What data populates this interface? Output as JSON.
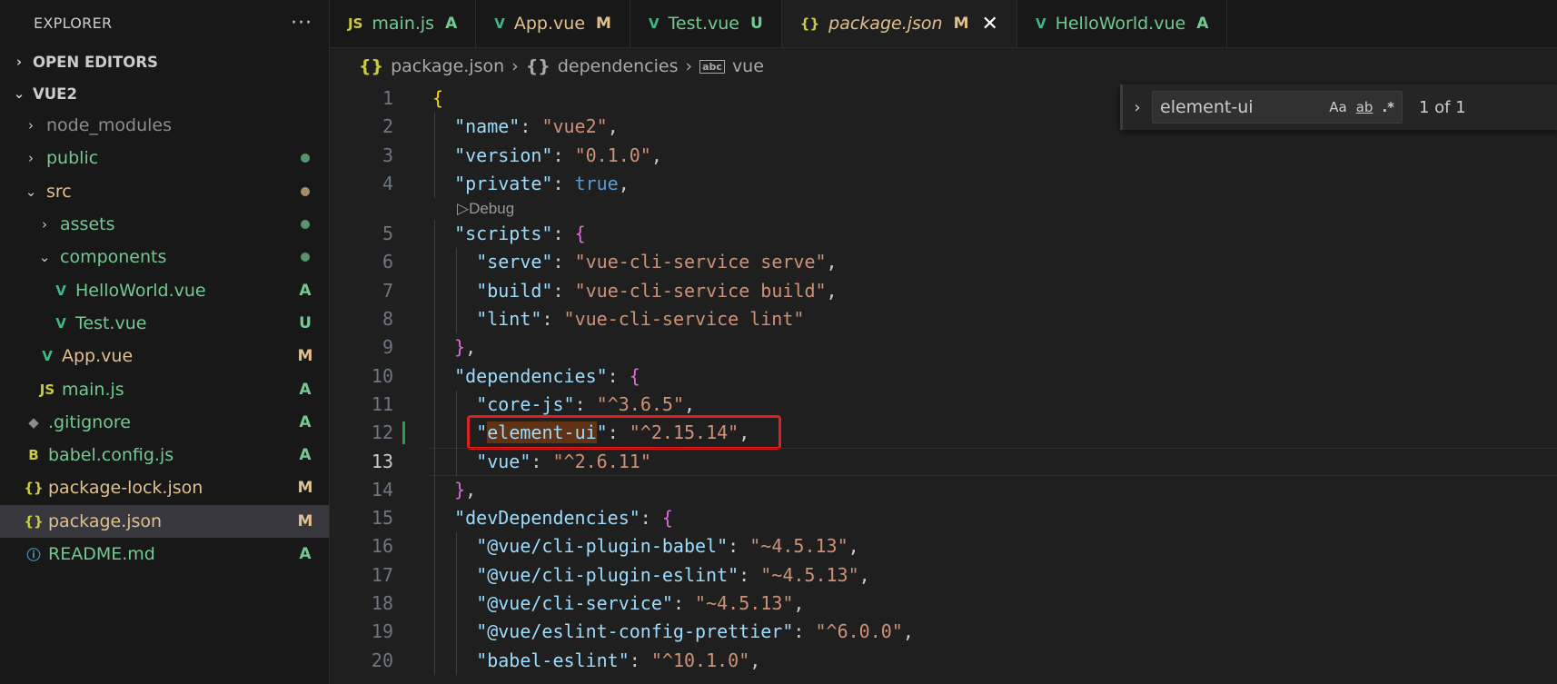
{
  "colors": {
    "vue_green": "#41b883",
    "js_yellow": "#cbcb41",
    "json_yellow": "#cbcb41",
    "added": "#73c991",
    "modified": "#e2c08d",
    "untracked": "#73c991",
    "folder_text": "#cccccc",
    "ignored": "#8c8c8c"
  },
  "sidebar": {
    "title": "EXPLORER",
    "more": "···",
    "open_editors": "OPEN EDITORS",
    "project": "VUE2",
    "tree": [
      {
        "label": "node_modules",
        "status": "",
        "icon": "chevron-right-icon",
        "glyph": "›",
        "depth": 1,
        "color": "#8c8c8c",
        "dot": ""
      },
      {
        "label": "public",
        "status": "",
        "icon": "chevron-right-icon",
        "glyph": "›",
        "depth": 1,
        "color": "#73c991",
        "dot": "#73c991"
      },
      {
        "label": "src",
        "status": "",
        "icon": "chevron-down-icon",
        "glyph": "⌄",
        "depth": 1,
        "color": "#e2c08d",
        "dot": "#e2c08d"
      },
      {
        "label": "assets",
        "status": "",
        "icon": "chevron-right-icon",
        "glyph": "›",
        "depth": 2,
        "color": "#73c991",
        "dot": "#73c991"
      },
      {
        "label": "components",
        "status": "",
        "icon": "chevron-down-icon",
        "glyph": "⌄",
        "depth": 2,
        "color": "#73c991",
        "dot": "#73c991"
      },
      {
        "label": "HelloWorld.vue",
        "status": "A",
        "icon": "vue-file-icon",
        "glyph": "V",
        "depth": 3,
        "color": "#73c991",
        "dot": ""
      },
      {
        "label": "Test.vue",
        "status": "U",
        "icon": "vue-file-icon",
        "glyph": "V",
        "depth": 3,
        "color": "#73c991",
        "dot": ""
      },
      {
        "label": "App.vue",
        "status": "M",
        "icon": "vue-file-icon",
        "glyph": "V",
        "depth": 2,
        "color": "#e2c08d",
        "dot": ""
      },
      {
        "label": "main.js",
        "status": "A",
        "icon": "js-file-icon",
        "glyph": "JS",
        "depth": 2,
        "color": "#73c991",
        "dot": ""
      },
      {
        "label": ".gitignore",
        "status": "A",
        "icon": "git-file-icon",
        "glyph": "◆",
        "depth": 1,
        "color": "#73c991",
        "dot": ""
      },
      {
        "label": "babel.config.js",
        "status": "A",
        "icon": "babel-file-icon",
        "glyph": "B",
        "depth": 1,
        "color": "#73c991",
        "dot": ""
      },
      {
        "label": "package-lock.json",
        "status": "M",
        "icon": "json-file-icon",
        "glyph": "{}",
        "depth": 1,
        "color": "#e2c08d",
        "dot": ""
      },
      {
        "label": "package.json",
        "status": "M",
        "icon": "json-file-icon",
        "glyph": "{}",
        "depth": 1,
        "color": "#e2c08d",
        "dot": "",
        "selected": true
      },
      {
        "label": "README.md",
        "status": "A",
        "icon": "info-icon",
        "glyph": "ⓘ",
        "depth": 1,
        "color": "#73c991",
        "dot": ""
      }
    ]
  },
  "tabs": [
    {
      "label": "main.js",
      "status": "A",
      "icon": "js-file-icon",
      "glyph": "JS",
      "color": "#73c991",
      "active": false
    },
    {
      "label": "App.vue",
      "status": "M",
      "icon": "vue-file-icon",
      "glyph": "V",
      "color": "#e2c08d",
      "active": false
    },
    {
      "label": "Test.vue",
      "status": "U",
      "icon": "vue-file-icon",
      "glyph": "V",
      "color": "#73c991",
      "active": false
    },
    {
      "label": "package.json",
      "status": "M",
      "icon": "json-file-icon",
      "glyph": "{}",
      "color": "#e2c08d",
      "active": true,
      "close": "✕"
    },
    {
      "label": "HelloWorld.vue",
      "status": "A",
      "icon": "vue-file-icon",
      "glyph": "V",
      "color": "#73c991",
      "active": false
    }
  ],
  "breadcrumb": {
    "file": "package.json",
    "section": "dependencies",
    "key": "vue",
    "sep": "›"
  },
  "codelens": "▷Debug",
  "code_lines": [
    {
      "n": "1",
      "indent": 0,
      "parts": [
        [
          "br1",
          "{"
        ]
      ]
    },
    {
      "n": "2",
      "indent": 1,
      "parts": [
        [
          "k",
          "\"name\""
        ],
        [
          "p",
          ": "
        ],
        [
          "s",
          "\"vue2\""
        ],
        [
          "p",
          ","
        ]
      ]
    },
    {
      "n": "3",
      "indent": 1,
      "parts": [
        [
          "k",
          "\"version\""
        ],
        [
          "p",
          ": "
        ],
        [
          "s",
          "\"0.1.0\""
        ],
        [
          "p",
          ","
        ]
      ]
    },
    {
      "n": "4",
      "indent": 1,
      "parts": [
        [
          "k",
          "\"private\""
        ],
        [
          "p",
          ": "
        ],
        [
          "b",
          "true"
        ],
        [
          "p",
          ","
        ]
      ]
    },
    {
      "n": "5",
      "indent": 1,
      "parts": [
        [
          "k",
          "\"scripts\""
        ],
        [
          "p",
          ": "
        ],
        [
          "br2",
          "{"
        ]
      ]
    },
    {
      "n": "6",
      "indent": 2,
      "parts": [
        [
          "k",
          "\"serve\""
        ],
        [
          "p",
          ": "
        ],
        [
          "s",
          "\"vue-cli-service serve\""
        ],
        [
          "p",
          ","
        ]
      ]
    },
    {
      "n": "7",
      "indent": 2,
      "parts": [
        [
          "k",
          "\"build\""
        ],
        [
          "p",
          ": "
        ],
        [
          "s",
          "\"vue-cli-service build\""
        ],
        [
          "p",
          ","
        ]
      ]
    },
    {
      "n": "8",
      "indent": 2,
      "parts": [
        [
          "k",
          "\"lint\""
        ],
        [
          "p",
          ": "
        ],
        [
          "s",
          "\"vue-cli-service lint\""
        ]
      ]
    },
    {
      "n": "9",
      "indent": 1,
      "parts": [
        [
          "br2",
          "}"
        ],
        [
          "p",
          ","
        ]
      ]
    },
    {
      "n": "10",
      "indent": 1,
      "parts": [
        [
          "k",
          "\"dependencies\""
        ],
        [
          "p",
          ": "
        ],
        [
          "br2",
          "{"
        ]
      ]
    },
    {
      "n": "11",
      "indent": 2,
      "parts": [
        [
          "k",
          "\"core-js\""
        ],
        [
          "p",
          ": "
        ],
        [
          "s",
          "\"^3.6.5\""
        ],
        [
          "p",
          ","
        ]
      ]
    },
    {
      "n": "12",
      "indent": 2,
      "parts": [
        [
          "k",
          "\""
        ],
        [
          "hl",
          "element-ui"
        ],
        [
          "k",
          "\""
        ],
        [
          "p",
          ": "
        ],
        [
          "s",
          "\"^2.15.14\""
        ],
        [
          "p",
          ","
        ]
      ]
    },
    {
      "n": "13",
      "indent": 2,
      "parts": [
        [
          "k",
          "\"vue\""
        ],
        [
          "p",
          ": "
        ],
        [
          "s",
          "\"^2.6.11\""
        ]
      ]
    },
    {
      "n": "14",
      "indent": 1,
      "parts": [
        [
          "br2",
          "}"
        ],
        [
          "p",
          ","
        ]
      ]
    },
    {
      "n": "15",
      "indent": 1,
      "parts": [
        [
          "k",
          "\"devDependencies\""
        ],
        [
          "p",
          ": "
        ],
        [
          "br2",
          "{"
        ]
      ]
    },
    {
      "n": "16",
      "indent": 2,
      "parts": [
        [
          "k",
          "\"@vue/cli-plugin-babel\""
        ],
        [
          "p",
          ": "
        ],
        [
          "s",
          "\"~4.5.13\""
        ],
        [
          "p",
          ","
        ]
      ]
    },
    {
      "n": "17",
      "indent": 2,
      "parts": [
        [
          "k",
          "\"@vue/cli-plugin-eslint\""
        ],
        [
          "p",
          ": "
        ],
        [
          "s",
          "\"~4.5.13\""
        ],
        [
          "p",
          ","
        ]
      ]
    },
    {
      "n": "18",
      "indent": 2,
      "parts": [
        [
          "k",
          "\"@vue/cli-service\""
        ],
        [
          "p",
          ": "
        ],
        [
          "s",
          "\"~4.5.13\""
        ],
        [
          "p",
          ","
        ]
      ]
    },
    {
      "n": "19",
      "indent": 2,
      "parts": [
        [
          "k",
          "\"@vue/eslint-config-prettier\""
        ],
        [
          "p",
          ": "
        ],
        [
          "s",
          "\"^6.0.0\""
        ],
        [
          "p",
          ","
        ]
      ]
    },
    {
      "n": "20",
      "indent": 2,
      "parts": [
        [
          "k",
          "\"babel-eslint\""
        ],
        [
          "p",
          ": "
        ],
        [
          "s",
          "\"^10.1.0\""
        ],
        [
          "p",
          ","
        ]
      ]
    }
  ],
  "current_line": "13",
  "find": {
    "value": "element-ui",
    "match_case": "Aa",
    "whole_word": "ab",
    "regex": ".*",
    "count": "1 of 1",
    "toggle": "›"
  }
}
